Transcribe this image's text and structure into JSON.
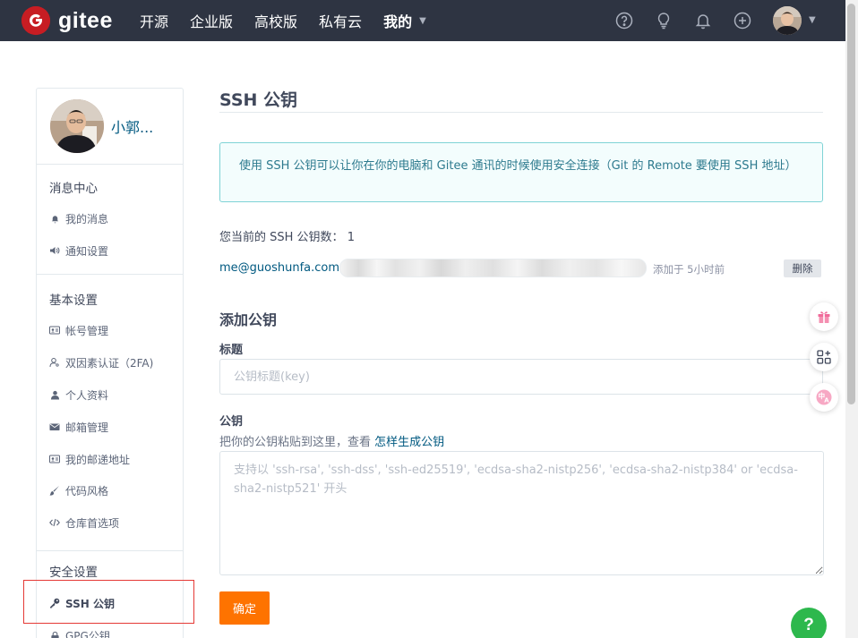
{
  "header": {
    "logo_text": "gitee",
    "logo_glyph": "G",
    "nav": [
      {
        "label": "开源"
      },
      {
        "label": "企业版"
      },
      {
        "label": "高校版"
      },
      {
        "label": "私有云"
      }
    ],
    "mine_label": "我的",
    "icons": [
      "help-circle-icon",
      "lightbulb-icon",
      "bell-icon",
      "plus-circle-icon"
    ]
  },
  "sidebar": {
    "user_name": "小郭...",
    "groups": [
      {
        "title": "消息中心",
        "items": [
          {
            "label": "我的消息",
            "icon": "bell-icon"
          },
          {
            "label": "通知设置",
            "icon": "speaker-icon"
          }
        ]
      },
      {
        "title": "基本设置",
        "items": [
          {
            "label": "帐号管理",
            "icon": "id-card-icon"
          },
          {
            "label": "双因素认证（2FA)",
            "icon": "user-key-icon"
          },
          {
            "label": "个人资料",
            "icon": "user-icon"
          },
          {
            "label": "邮箱管理",
            "icon": "mail-icon"
          },
          {
            "label": "我的邮递地址",
            "icon": "address-card-icon"
          },
          {
            "label": "代码风格",
            "icon": "brush-icon"
          },
          {
            "label": "仓库首选项",
            "icon": "code-icon"
          }
        ]
      },
      {
        "title": "安全设置",
        "items": [
          {
            "label": "SSH 公钥",
            "icon": "key-icon",
            "active": true
          },
          {
            "label": "GPG公钥",
            "icon": "lock-icon"
          }
        ]
      }
    ]
  },
  "main": {
    "title": "SSH 公钥",
    "info": "使用 SSH 公钥可以让你在你的电脑和 Gitee 通讯的时候使用安全连接（Git 的 Remote 要使用 SSH 地址）",
    "count_label": "您当前的 SSH 公钥数：",
    "count_value": "1",
    "keys": [
      {
        "email": "me@guoshunfa.com",
        "added": "添加于 5小时前",
        "delete_label": "删除"
      }
    ],
    "add_title": "添加公钥",
    "title_label": "标题",
    "title_placeholder": "公钥标题(key)",
    "key_label": "公钥",
    "hint_text": "把你的公钥粘贴到这里，查看 ",
    "hint_link": "怎样生成公钥",
    "key_placeholder": "支持以 'ssh-rsa', 'ssh-dss', 'ssh-ed25519', 'ecdsa-sha2-nistp256', 'ecdsa-sha2-nistp384' or 'ecdsa-sha2-nistp521' 开头",
    "submit_label": "确定"
  },
  "floating": {
    "icons": [
      "gift-icon",
      "qrcode-icon",
      "translate-icon"
    ],
    "help_label": "?"
  },
  "colors": {
    "header_bg": "#2e3442",
    "brand_red": "#c71d23",
    "accent_orange": "#fe7300",
    "link_blue": "#005980",
    "info_border": "#7fd3d6",
    "help_green": "#2db84d"
  }
}
